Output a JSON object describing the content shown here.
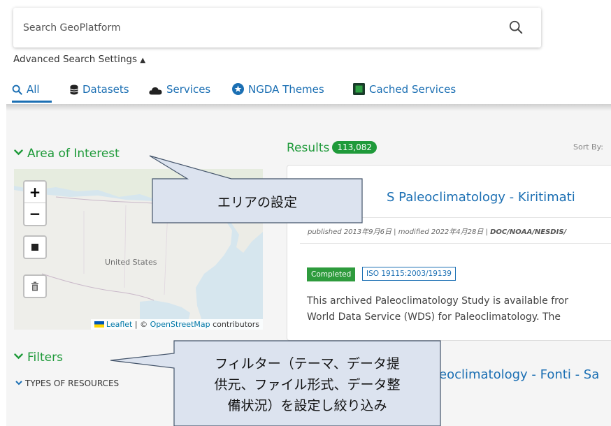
{
  "search": {
    "placeholder": "Search GeoPlatform",
    "icon": "search-icon"
  },
  "advanced": {
    "label": "Advanced Search Settings",
    "toggle_glyph": "▲"
  },
  "tabs": [
    {
      "label": "All",
      "icon": "search-icon",
      "active": true
    },
    {
      "label": "Datasets",
      "icon": "database-icon"
    },
    {
      "label": "Services",
      "icon": "cloud-icon"
    },
    {
      "label": "NGDA Themes",
      "icon": "star-circle-icon"
    },
    {
      "label": "Cached Services",
      "icon": "square-icon"
    }
  ],
  "area_of_interest": {
    "title": "Area of Interest",
    "map": {
      "zoom_in": "+",
      "zoom_out": "−",
      "country_label": "United States",
      "attribution": {
        "leaflet": "Leaflet",
        "separator": " | © ",
        "osm": "OpenStreetMap",
        "suffix": " contributors"
      }
    }
  },
  "filters": {
    "title": "Filters",
    "types_label": "TYPES OF RESOURCES"
  },
  "results": {
    "label": "Results",
    "count": "113,082",
    "sort_label": "Sort By:"
  },
  "result_card": {
    "title": "S Paleoclimatology - Kiritimati",
    "meta_prefix": "published 2013年9月6日 | modified 2022年4月28日 | ",
    "meta_publisher": "DOC/NOAA/NESDIS/",
    "status_badge": "Completed",
    "standard_badge": "ISO 19115:2003/19139",
    "desc_line1": "This archived Paleoclimatology Study is available fror",
    "desc_line2": "World Data Service (WDS) for Paleoclimatology. The"
  },
  "result_card_2": {
    "title": "eoclimatology - Fonti - Sa"
  },
  "callouts": {
    "area": "エリアの設定",
    "filters_line1": "フィルター（テーマ、データ提",
    "filters_line2": "供元、ファイル形式、データ整",
    "filters_line3": "備状況）を設定し絞り込み"
  },
  "colors": {
    "link_blue": "#1b6fb3",
    "green": "#1f9a3a",
    "callout_fill": "#dce3ef"
  }
}
